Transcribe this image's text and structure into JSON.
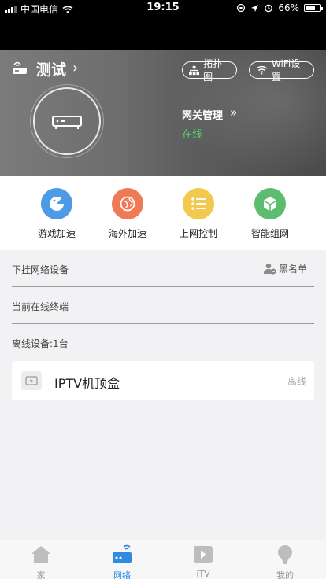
{
  "status_bar": {
    "carrier": "中国电信",
    "time": "19:15",
    "battery": "66%",
    "battery_level": 0.66
  },
  "header": {
    "network_name": "测试",
    "topology_label": "拓扑图",
    "wifi_label": "WiFi设置",
    "gateway_title": "网关管理",
    "gateway_status": "在线"
  },
  "quick_actions": [
    {
      "label": "游戏加速",
      "icon": "game-icon",
      "color": "#4d9be6"
    },
    {
      "label": "海外加速",
      "icon": "globe-icon",
      "color": "#ef7a56"
    },
    {
      "label": "上网控制",
      "icon": "control-list-icon",
      "color": "#f2c94e"
    },
    {
      "label": "智能组网",
      "icon": "cube-icon",
      "color": "#5bbd6d"
    }
  ],
  "sections": {
    "attached": "下挂网络设备",
    "blacklist": "黑名单",
    "online": "当前在线终端",
    "offline": "离线设备:1台"
  },
  "offline_devices": [
    {
      "name": "IPTV机顶盒",
      "status": "离线"
    }
  ],
  "tabbar": [
    {
      "label": "家"
    },
    {
      "label": "网络",
      "active": true
    },
    {
      "label": "iTV"
    },
    {
      "label": "我的"
    }
  ],
  "colors": {
    "accent": "#2f8ae0",
    "online": "#55d66a"
  }
}
